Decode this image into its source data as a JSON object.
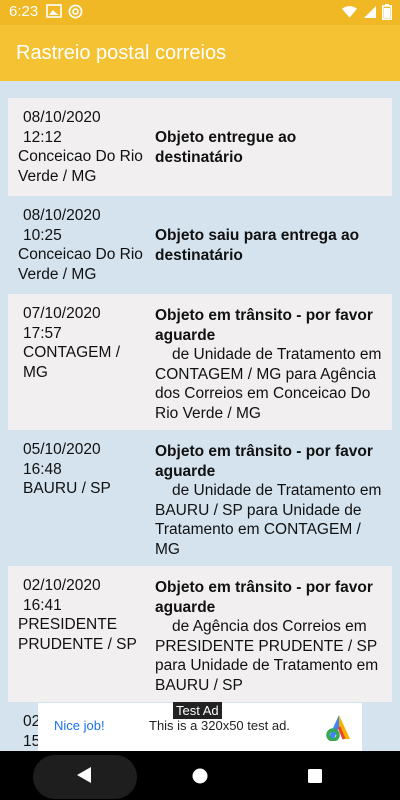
{
  "status_bar": {
    "time": "6:23"
  },
  "app_bar": {
    "title": "Rastreio postal correios"
  },
  "events": [
    {
      "date": "08/10/2020",
      "time": "12:12",
      "location": "Conceicao Do Rio Verde / MG",
      "status": "Objeto entregue ao destinatário",
      "detail": ""
    },
    {
      "date": "08/10/2020",
      "time": "10:25",
      "location": "Conceicao Do Rio Verde / MG",
      "status": "Objeto saiu para entrega ao destinatário",
      "detail": ""
    },
    {
      "date": "07/10/2020",
      "time": "17:57",
      "location": "CONTAGEM / MG",
      "status": "Objeto em trânsito - por favor aguarde",
      "detail": "de Unidade de Tratamento em CONTAGEM / MG para Agência dos Correios em Conceicao Do Rio Verde / MG"
    },
    {
      "date": "05/10/2020",
      "time": "16:48",
      "location": "BAURU / SP",
      "status": "Objeto em trânsito - por favor aguarde",
      "detail": "de Unidade de Tratamento em BAURU / SP para Unidade de Tratamento em CONTAGEM / MG"
    },
    {
      "date": "02/10/2020",
      "time": "16:41",
      "location": "PRESIDENTE PRUDENTE / SP",
      "status": "Objeto em trânsito - por favor aguarde",
      "detail": "de Agência dos Correios em PRESIDENTE PRUDENTE / SP para Unidade de Tratamento em BAURU / SP"
    },
    {
      "date": "02",
      "time": "15",
      "location": "",
      "status": "",
      "detail": ""
    }
  ],
  "ad": {
    "tag": "Test Ad",
    "nice": "Nice job!",
    "text": "This is a 320x50 test ad."
  },
  "icons": {
    "status_left": [
      "photo-icon",
      "at-sign-icon"
    ],
    "status_right": [
      "wifi-icon",
      "signal-icon",
      "battery-icon"
    ],
    "nav": [
      "back-icon",
      "home-icon",
      "recents-icon"
    ]
  },
  "colors": {
    "app_bar": "#f4c233",
    "status_bar": "#f0b825",
    "background": "#d4e3ee",
    "card": "#f1eff0",
    "ad_link": "#1a73e8"
  }
}
